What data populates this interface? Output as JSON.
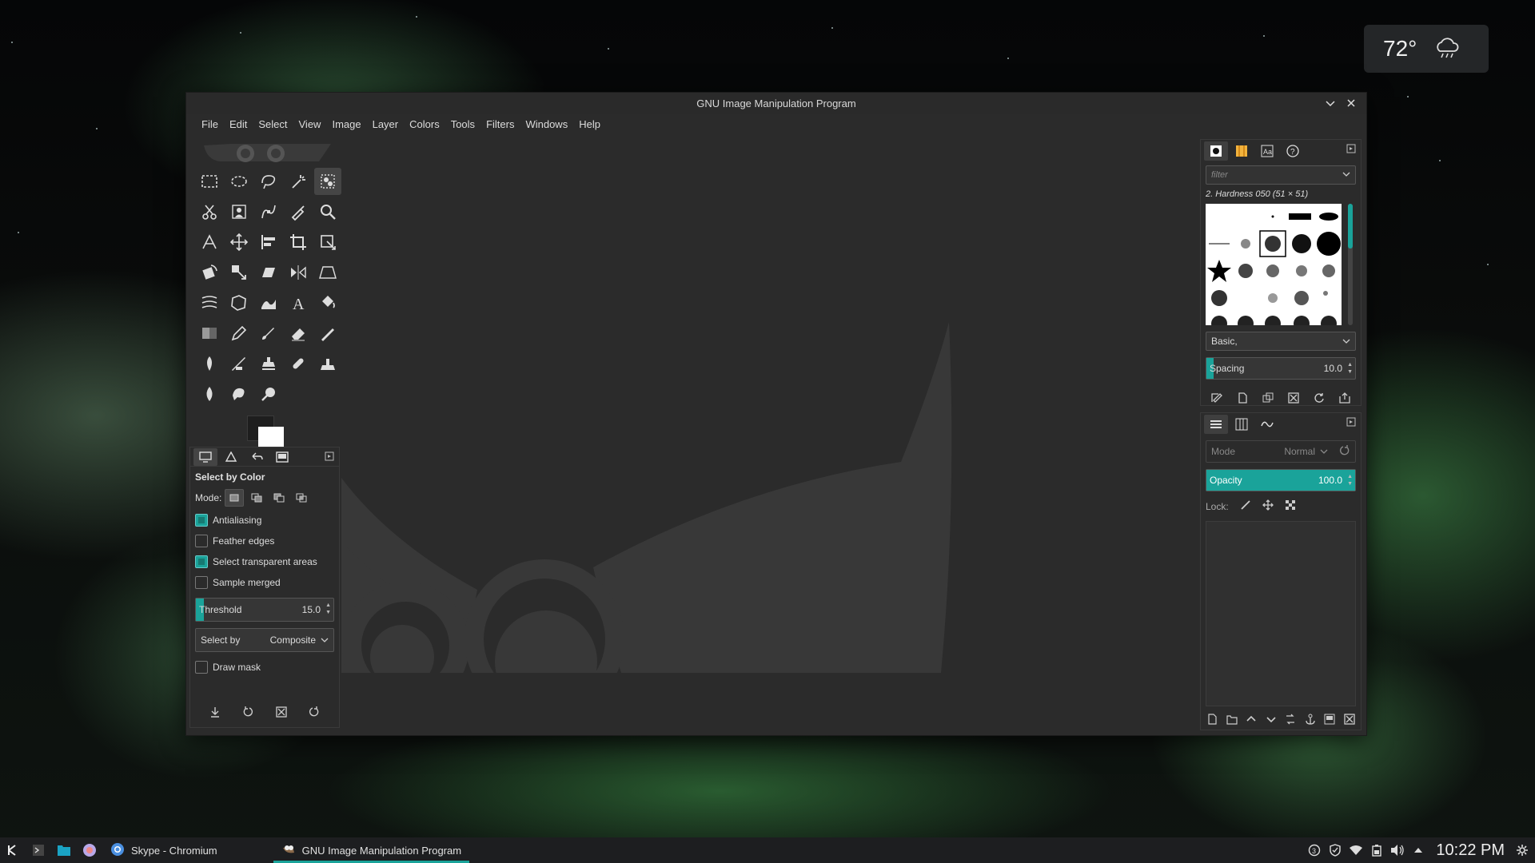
{
  "weather": {
    "temperature": "72°",
    "icon": "rain-cloud-icon"
  },
  "window": {
    "title": "GNU Image Manipulation Program",
    "buttons": [
      "minimize-chevron-icon",
      "close-icon"
    ]
  },
  "menu": [
    "File",
    "Edit",
    "Select",
    "View",
    "Image",
    "Layer",
    "Colors",
    "Tools",
    "Filters",
    "Windows",
    "Help"
  ],
  "toolbox": {
    "active_tool": "select-by-color",
    "tools": [
      "rect-select",
      "ellipse-select",
      "free-select",
      "fuzzy-select",
      "select-by-color",
      "scissors-select",
      "foreground-select",
      "paths-tool",
      "color-picker",
      "zoom-tool",
      "measure-tool",
      "move-tool",
      "align-tool",
      "crop-tool",
      "unified-transform",
      "rotate-tool",
      "scale-tool",
      "shear-tool",
      "flip-tool",
      "perspective-tool",
      "warp-transform",
      "cage-transform",
      "smudge-wave-tool",
      "text-tool",
      "bucket-fill",
      "gradient-tool",
      "pencil-tool",
      "paintbrush-tool",
      "eraser-tool",
      "airbrush-tool",
      "ink-tool",
      "mypaint-brush",
      "clone-tool",
      "heal-tool",
      "perspective-clone",
      "blur-sharpen",
      "smudge-tool",
      "dodge-burn"
    ]
  },
  "tool_options": {
    "title": "Select by Color",
    "mode_label": "Mode:",
    "checkboxes": [
      {
        "label": "Antialiasing",
        "checked": true
      },
      {
        "label": "Feather edges",
        "checked": false
      },
      {
        "label": "Select transparent areas",
        "checked": true
      },
      {
        "label": "Sample merged",
        "checked": false
      }
    ],
    "threshold": {
      "label": "Threshold",
      "value": "15.0",
      "fraction": 0.06
    },
    "select_by": {
      "label": "Select by",
      "value": "Composite"
    },
    "draw_mask": {
      "label": "Draw mask",
      "checked": false
    }
  },
  "brushes": {
    "filter_placeholder": "filter",
    "selected": "2. Hardness 050 (51 × 51)",
    "tag": "Basic,",
    "spacing": {
      "label": "Spacing",
      "value": "10.0",
      "fraction": 0.05
    }
  },
  "layers": {
    "mode_label": "Mode",
    "mode_value": "Normal",
    "opacity": {
      "label": "Opacity",
      "value": "100.0",
      "fraction": 1.0
    },
    "lock_label": "Lock:"
  },
  "taskbar": {
    "tasks": [
      {
        "label": "Skype - Chromium",
        "active": false
      },
      {
        "label": "GNU Image Manipulation Program",
        "active": true
      }
    ],
    "clock": "10:22 PM"
  },
  "colors": {
    "accent": "#1aa39a",
    "panel": "#2b2b2b"
  }
}
